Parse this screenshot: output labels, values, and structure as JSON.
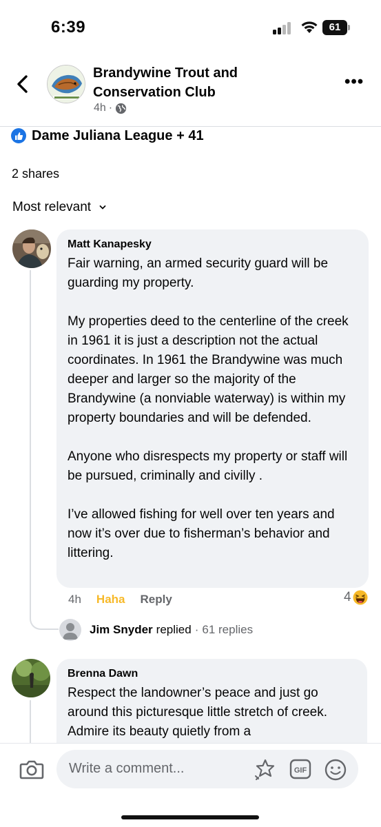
{
  "status_bar": {
    "time": "6:39",
    "battery": "61"
  },
  "header": {
    "page_name": "Brandywine Trout and Conservation Club",
    "time_ago": "4h",
    "separator": "·",
    "more_label": "•••"
  },
  "reactions": {
    "summary": "Dame Juliana League + 41"
  },
  "shares": "2 shares",
  "sort": {
    "label": "Most relevant"
  },
  "comments": [
    {
      "author": "Matt Kanapesky",
      "text": "Fair warning, an armed security guard will be guarding my property.\n\nMy properties deed to the centerline of the creek in 1961  it is just a description not the actual coordinates. In 1961 the Brandywine was much deeper and larger so the majority of the Brandywine (a nonviable waterway) is within my property boundaries and will be defended.\n\nAnyone who disrespects my property or staff will be pursued, criminally and civilly .\n\nI’ve allowed fishing for well over ten years and now it’s over due to fisherman’s behavior and littering.",
      "time": "4h",
      "reaction_label": "Haha",
      "reply_label": "Reply",
      "reaction_count": "4",
      "reply_preview": {
        "name": "Jim Snyder",
        "verb": "replied",
        "separator": "·",
        "count": "61 replies"
      }
    },
    {
      "author": "Brenna Dawn",
      "text": "Respect the landowner’s peace and just go around this picturesque little stretch of creek. Admire its beauty quietly from a"
    }
  ],
  "composer": {
    "placeholder": "Write a comment..."
  },
  "colors": {
    "like_blue": "#1b74e4",
    "haha_yellow": "#f7b928",
    "bubble_bg": "#f0f2f5",
    "muted_text": "#65676b"
  }
}
